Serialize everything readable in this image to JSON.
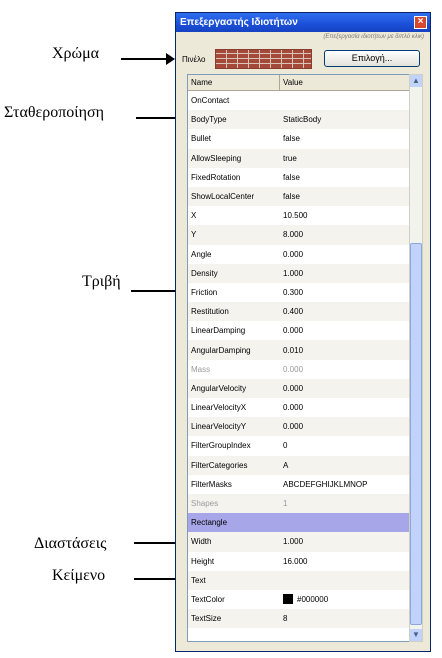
{
  "annotations": {
    "color": "Χρώμα",
    "stabilization": "Σταθεροποίηση",
    "friction": "Τριβή",
    "dimensions": "Διαστάσεις",
    "text": "Κείμενο"
  },
  "window": {
    "title": "Επεξεργαστής Ιδιοτήτων",
    "hint": "(Επεξεργασία ιδιοτήτων με διπλό κλικ)",
    "brush_label": "Πινέλο",
    "choose_button": "Επιλογή..."
  },
  "grid": {
    "columns": [
      "Name",
      "Value"
    ],
    "rows": [
      {
        "name": "OnContact",
        "value": ""
      },
      {
        "name": "BodyType",
        "value": "StaticBody"
      },
      {
        "name": "Bullet",
        "value": "false"
      },
      {
        "name": "AllowSleeping",
        "value": "true"
      },
      {
        "name": "FixedRotation",
        "value": "false"
      },
      {
        "name": "ShowLocalCenter",
        "value": "false"
      },
      {
        "name": "X",
        "value": "10.500"
      },
      {
        "name": "Y",
        "value": "8.000"
      },
      {
        "name": "Angle",
        "value": "0.000"
      },
      {
        "name": "Density",
        "value": "1.000"
      },
      {
        "name": "Friction",
        "value": "0.300"
      },
      {
        "name": "Restitution",
        "value": "0.400"
      },
      {
        "name": "LinearDamping",
        "value": "0.000"
      },
      {
        "name": "AngularDamping",
        "value": "0.010"
      },
      {
        "name": "Mass",
        "value": "0.000",
        "disabled": true
      },
      {
        "name": "AngularVelocity",
        "value": "0.000"
      },
      {
        "name": "LinearVelocityX",
        "value": "0.000"
      },
      {
        "name": "LinearVelocityY",
        "value": "0.000"
      },
      {
        "name": "FilterGroupIndex",
        "value": "0"
      },
      {
        "name": "FilterCategories",
        "value": "A"
      },
      {
        "name": "FilterMasks",
        "value": "ABCDEFGHIJKLMNOP"
      },
      {
        "name": "Shapes",
        "value": "1",
        "disabled": true
      },
      {
        "name": "Rectangle",
        "value": "",
        "selected": true
      },
      {
        "name": "Width",
        "value": "1.000"
      },
      {
        "name": "Height",
        "value": "16.000"
      },
      {
        "name": "Text",
        "value": ""
      },
      {
        "name": "TextColor",
        "value": "#000000",
        "swatch": "#000000"
      },
      {
        "name": "TextSize",
        "value": "8"
      }
    ]
  },
  "colors": {
    "title_bar": "#1b4fd8",
    "selected_row": "#a7a6e8",
    "brick": "#a54a3b"
  },
  "icons": {
    "close": "close-icon",
    "scroll_up": "chevron-up-icon",
    "scroll_down": "chevron-down-icon"
  }
}
